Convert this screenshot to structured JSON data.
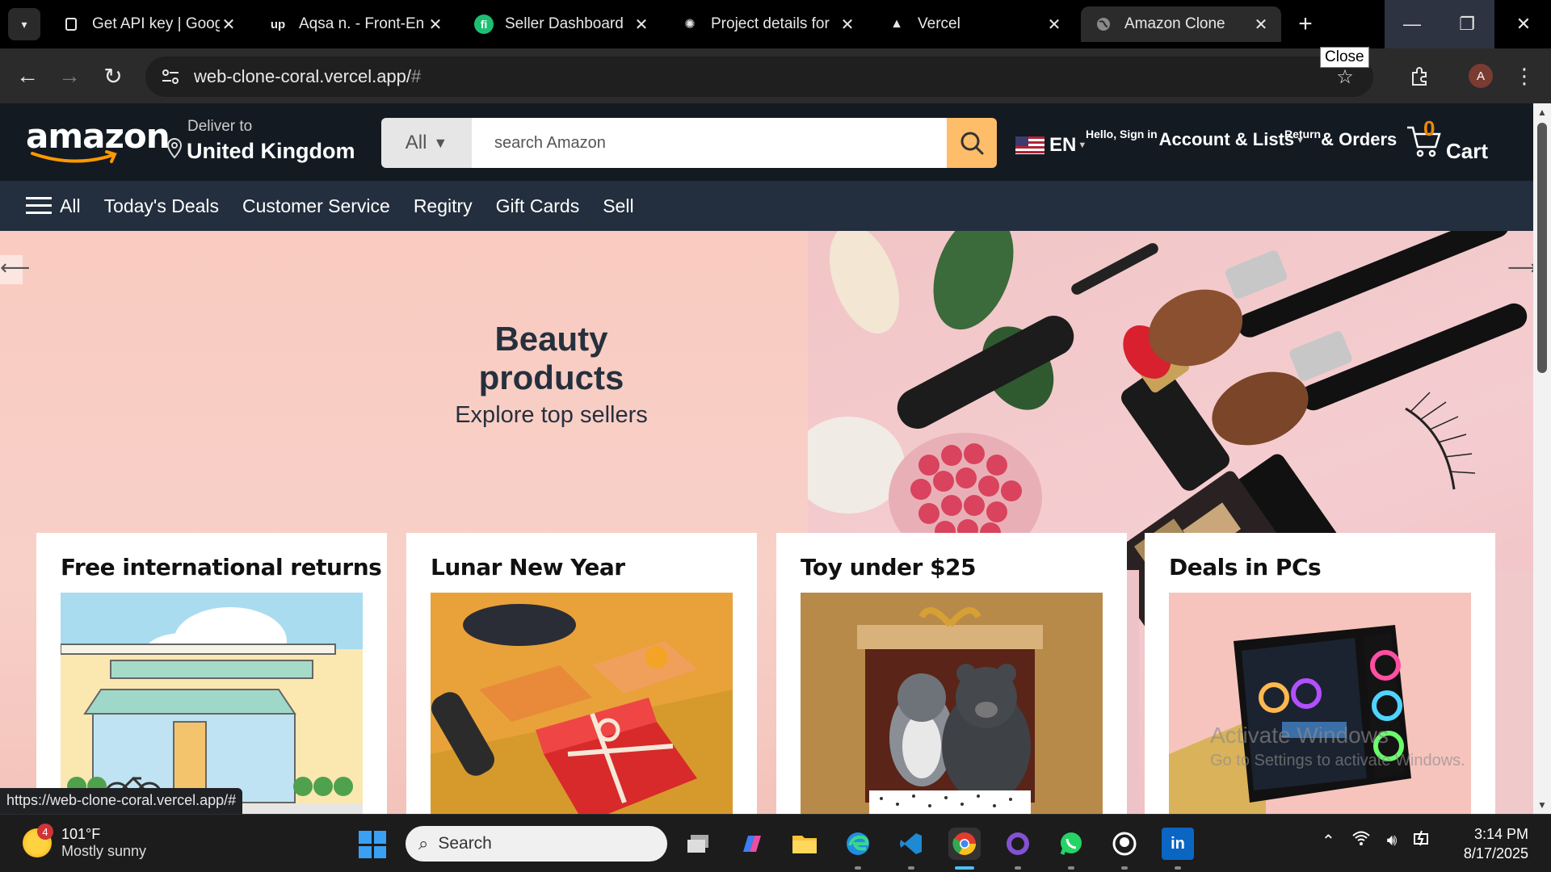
{
  "browser": {
    "tabs": [
      {
        "title": "Get API key | Goog",
        "icon": "page-icon"
      },
      {
        "title": "Aqsa n. - Front-En",
        "icon": "upwork-icon"
      },
      {
        "title": "Seller Dashboard",
        "icon": "fiverr-icon"
      },
      {
        "title": "Project details for",
        "icon": "openai-icon"
      },
      {
        "title": "Vercel",
        "icon": "vercel-icon"
      },
      {
        "title": "Amazon Clone",
        "icon": "globe-icon",
        "active": true
      }
    ],
    "url": "web-clone-coral.vercel.app/",
    "url_suffix": "#",
    "tooltip": "Close",
    "profile_initial": "A",
    "status_url": "https://web-clone-coral.vercel.app/#"
  },
  "amazon": {
    "logo": "amazon",
    "deliver_label": "Deliver to",
    "deliver_location": "United Kingdom",
    "search_category": "All",
    "search_placeholder": "search Amazon",
    "lang": "EN",
    "account_small": "Hello, Sign in",
    "account_big": "Account & Lists",
    "orders_small": "Return",
    "orders_big": "& Orders",
    "cart_count": "0",
    "cart_label": "Cart",
    "nav": [
      "All",
      "Today's Deals",
      "Customer Service",
      "Regitry",
      "Gift Cards",
      "Sell"
    ],
    "hero_title": "Beauty products",
    "hero_subtitle": "Explore top sellers",
    "arrow_left": "⟵",
    "arrow_right": "⟶",
    "cards": [
      {
        "title": "Free international returns"
      },
      {
        "title": "Lunar New Year"
      },
      {
        "title": "Toy under $25"
      },
      {
        "title": "Deals in PCs"
      }
    ]
  },
  "watermark": {
    "line1": "Activate Windows",
    "line2": "Go to Settings to activate Windows."
  },
  "taskbar": {
    "weather_temp": "101°F",
    "weather_cond": "Mostly sunny",
    "weather_badge": "4",
    "search_label": "Search",
    "time": "3:14 PM",
    "date": "8/17/2025"
  },
  "colors": {
    "amazon_header": "#131a22",
    "amazon_nav": "#232f3e",
    "search_button": "#febd69",
    "cart_count": "#f08804",
    "hero_bg": "#f6ccc4"
  }
}
